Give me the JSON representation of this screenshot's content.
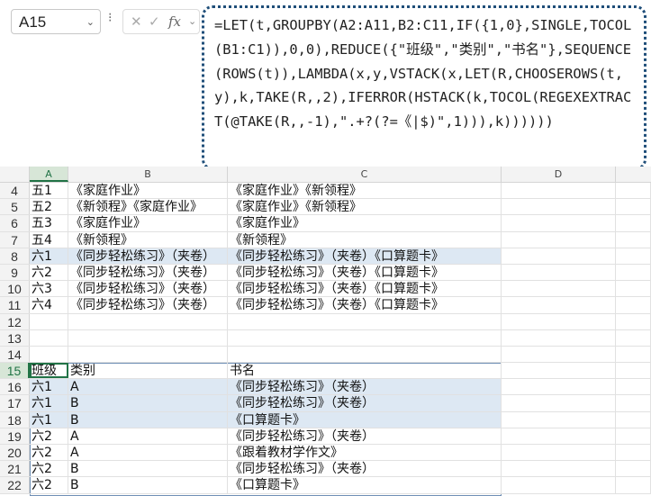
{
  "name_box": {
    "value": "A15"
  },
  "formula_bar": {
    "fx": "fx",
    "formula": "=LET(t,GROUPBY(A2:A11,B2:C11,IF({1,0},SINGLE,TOCOL(B1:C1)),0,0),REDUCE({\"班级\",\"类别\",\"书名\"},SEQUENCE(ROWS(t)),LAMBDA(x,y,VSTACK(x,LET(R,CHOOSEROWS(t,y),k,TAKE(R,,2),IFERROR(HSTACK(k,TOCOL(REGEXEXTRACT(@TAKE(R,,-1),\".+?(?=《|$)\",1))),k))))))"
  },
  "columns": [
    "A",
    "B",
    "C",
    "D"
  ],
  "rows": [
    {
      "num": "4",
      "a": "五1",
      "b": "《家庭作业》",
      "c": "《家庭作业》《新领程》"
    },
    {
      "num": "5",
      "a": "五2",
      "b": "《新领程》《家庭作业》",
      "c": "《家庭作业》《新领程》"
    },
    {
      "num": "6",
      "a": "五3",
      "b": "《家庭作业》",
      "c": "《家庭作业》"
    },
    {
      "num": "7",
      "a": "五4",
      "b": "《新领程》",
      "c": "《新领程》"
    },
    {
      "num": "8",
      "a": "六1",
      "b": "《同步轻松练习》（夹卷）",
      "c": "《同步轻松练习》（夹卷）《口算题卡》"
    },
    {
      "num": "9",
      "a": "六2",
      "b": "《同步轻松练习》（夹卷）",
      "c": "《同步轻松练习》（夹卷）《口算题卡》"
    },
    {
      "num": "10",
      "a": "六3",
      "b": "《同步轻松练习》（夹卷）",
      "c": "《同步轻松练习》（夹卷）《口算题卡》"
    },
    {
      "num": "11",
      "a": "六4",
      "b": "《同步轻松练习》（夹卷）",
      "c": "《同步轻松练习》（夹卷）《口算题卡》"
    },
    {
      "num": "12",
      "a": "",
      "b": "",
      "c": ""
    },
    {
      "num": "13",
      "a": "",
      "b": "",
      "c": ""
    },
    {
      "num": "14",
      "a": "",
      "b": "",
      "c": ""
    },
    {
      "num": "15",
      "a": "班级",
      "b": "类别",
      "c": "书名"
    },
    {
      "num": "16",
      "a": "六1",
      "b": "A",
      "c": "《同步轻松练习》（夹卷）"
    },
    {
      "num": "17",
      "a": "六1",
      "b": "B",
      "c": "《同步轻松练习》（夹卷）"
    },
    {
      "num": "18",
      "a": "六1",
      "b": "B",
      "c": "《口算题卡》"
    },
    {
      "num": "19",
      "a": "六2",
      "b": "A",
      "c": "《同步轻松练习》（夹卷）"
    },
    {
      "num": "20",
      "a": "六2",
      "b": "A",
      "c": "《跟着教材学作文》"
    },
    {
      "num": "21",
      "a": "六2",
      "b": "B",
      "c": "《同步轻松练习》（夹卷）"
    },
    {
      "num": "22",
      "a": "六2",
      "b": "B",
      "c": "《口算题卡》"
    }
  ],
  "accent_color": "#217346",
  "highlight_color": "#dde8f3"
}
